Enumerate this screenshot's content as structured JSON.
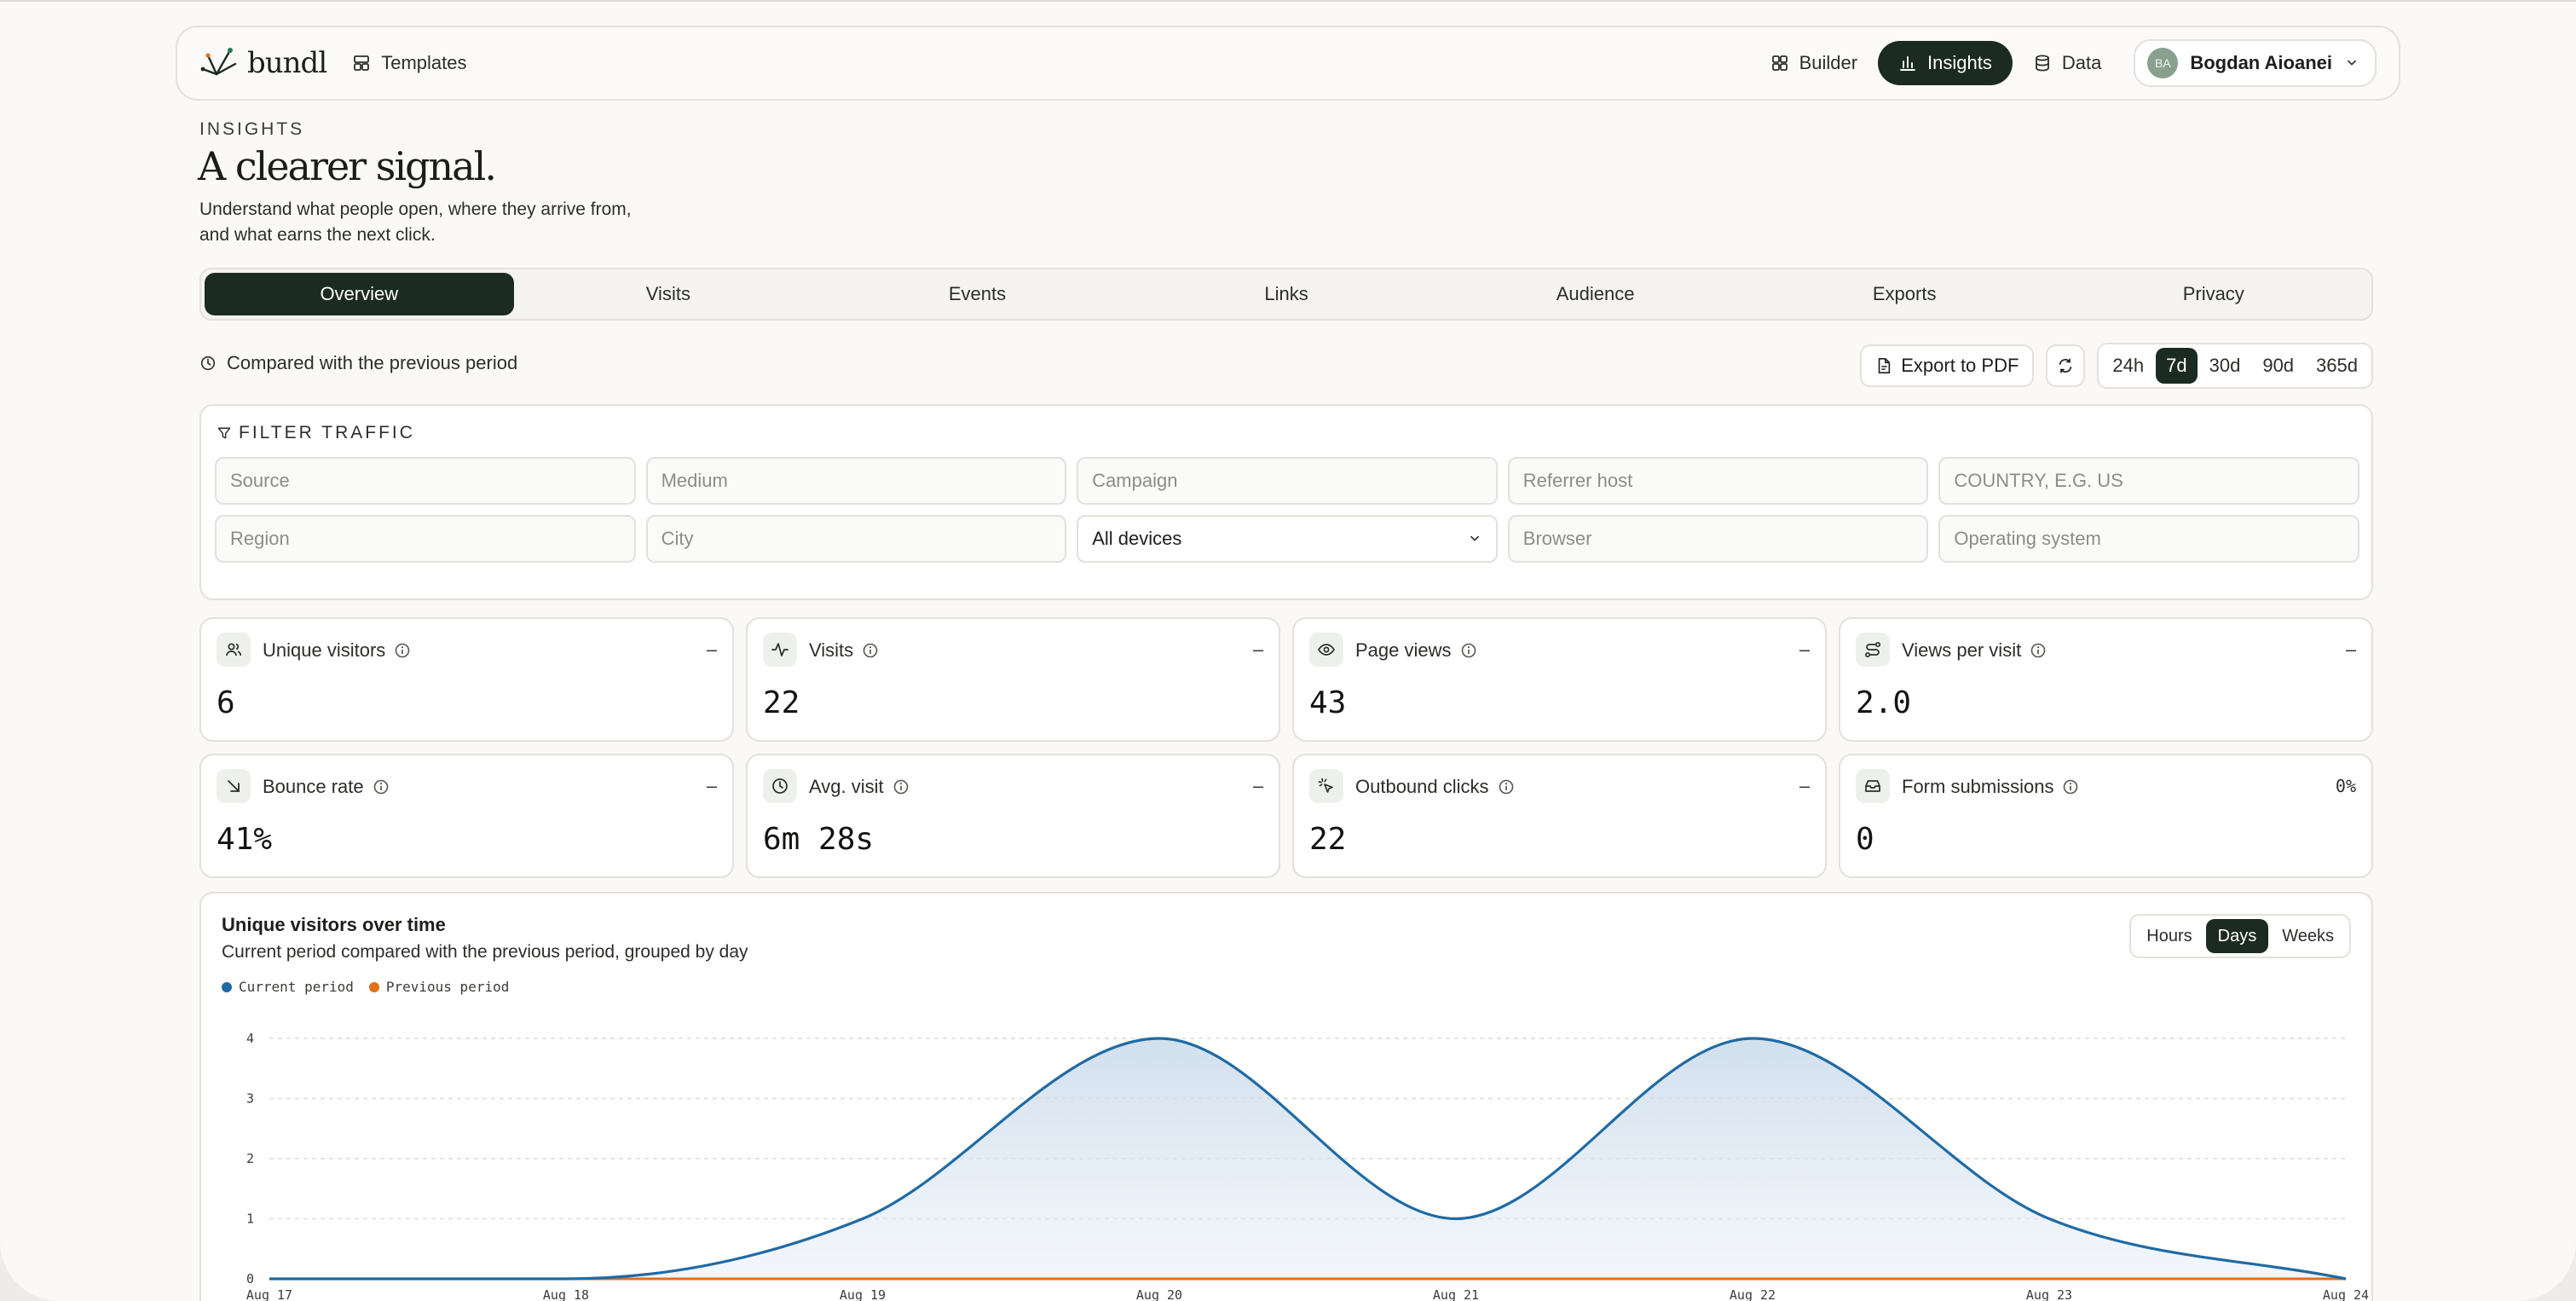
{
  "brand": {
    "name": "bundl"
  },
  "nav": {
    "templates": "Templates",
    "builder": "Builder",
    "insights": "Insights",
    "data": "Data"
  },
  "user": {
    "initials": "BA",
    "name": "Bogdan Aioanei"
  },
  "header": {
    "eyebrow": "INSIGHTS",
    "title": "A clearer signal.",
    "subtitle_line1": "Understand what people open, where they arrive from,",
    "subtitle_line2": "and what earns the next click."
  },
  "tabs": [
    "Overview",
    "Visits",
    "Events",
    "Links",
    "Audience",
    "Exports",
    "Privacy"
  ],
  "active_tab": "Overview",
  "compare_text": "Compared with the previous period",
  "export_label": "Export to PDF",
  "ranges": [
    "24h",
    "7d",
    "30d",
    "90d",
    "365d"
  ],
  "active_range": "7d",
  "filter": {
    "title": "FILTER TRAFFIC",
    "fields": {
      "source": "Source",
      "medium": "Medium",
      "campaign": "Campaign",
      "referrer": "Referrer host",
      "country": "COUNTRY, E.G. US",
      "region": "Region",
      "city": "City",
      "devices": "All devices",
      "browser": "Browser",
      "os": "Operating system"
    }
  },
  "stats": [
    {
      "label": "Unique visitors",
      "value": "6",
      "delta": "–",
      "icon": "users-icon"
    },
    {
      "label": "Visits",
      "value": "22",
      "delta": "–",
      "icon": "activity-icon"
    },
    {
      "label": "Page views",
      "value": "43",
      "delta": "–",
      "icon": "eye-icon"
    },
    {
      "label": "Views per visit",
      "value": "2.0",
      "delta": "–",
      "icon": "route-icon"
    },
    {
      "label": "Bounce rate",
      "value": "41%",
      "delta": "–",
      "icon": "arrow-down-right-icon"
    },
    {
      "label": "Avg. visit",
      "value": "6m 28s",
      "delta": "–",
      "icon": "clock-icon"
    },
    {
      "label": "Outbound clicks",
      "value": "22",
      "delta": "–",
      "icon": "click-icon"
    },
    {
      "label": "Form submissions",
      "value": "0",
      "delta": "0%",
      "icon": "mail-icon"
    }
  ],
  "chart": {
    "title": "Unique visitors over time",
    "subtitle": "Current period compared with the previous period, grouped by day",
    "granularity": [
      "Hours",
      "Days",
      "Weeks"
    ],
    "active_granularity": "Days"
  },
  "chart_data": {
    "type": "area",
    "categories": [
      "Aug 17",
      "Aug 18",
      "Aug 19",
      "Aug 20",
      "Aug 21",
      "Aug 22",
      "Aug 23",
      "Aug 24"
    ],
    "series": [
      {
        "name": "Current period",
        "values": [
          0,
          0,
          1,
          4,
          1,
          4,
          1,
          0
        ],
        "color": "#1f6aa5"
      },
      {
        "name": "Previous period",
        "values": [
          0,
          0,
          0,
          0,
          0,
          0,
          0,
          0
        ],
        "color": "#e0701c"
      }
    ],
    "ylim": [
      0,
      4
    ],
    "yticks": [
      0,
      1,
      2,
      3,
      4
    ],
    "grid": true,
    "legend": "top-left"
  }
}
